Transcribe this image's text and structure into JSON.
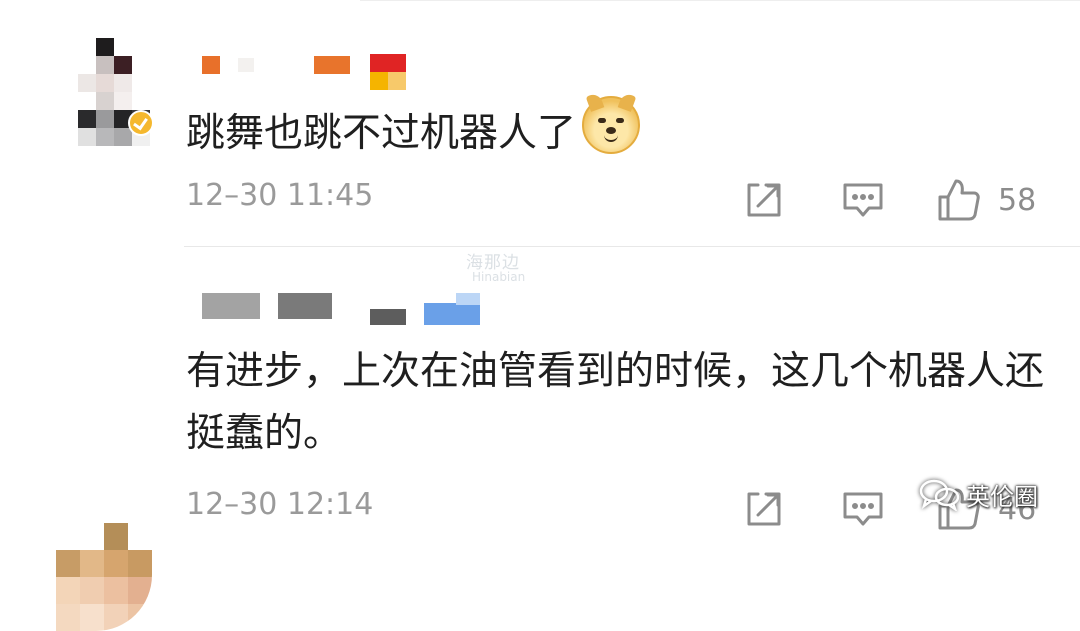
{
  "watermark": {
    "text_cn": "海那边",
    "text_en": "Hinabian"
  },
  "brand_mark": {
    "text": "英伦圈"
  },
  "comments": [
    {
      "text": "跳舞也跳不过机器人了",
      "emoji": "doge-emoji",
      "timestamp": "12–30 11:45",
      "like_count": "58",
      "verified_badge_color": "#f5b82e"
    },
    {
      "text": "有进步，上次在油管看到的时候，这几个机器人还挺蠢的。",
      "timestamp": "12–30 12:14",
      "like_count": "46"
    }
  ],
  "icons": {
    "share": "share-icon",
    "reply": "comment-icon",
    "like": "thumbs-up-icon",
    "brand": "wechat-icon"
  },
  "colors": {
    "text": "#1f1f1f",
    "meta": "#9a9a9a",
    "icon": "#8c8c8c",
    "divider": "#e8e8e8"
  }
}
